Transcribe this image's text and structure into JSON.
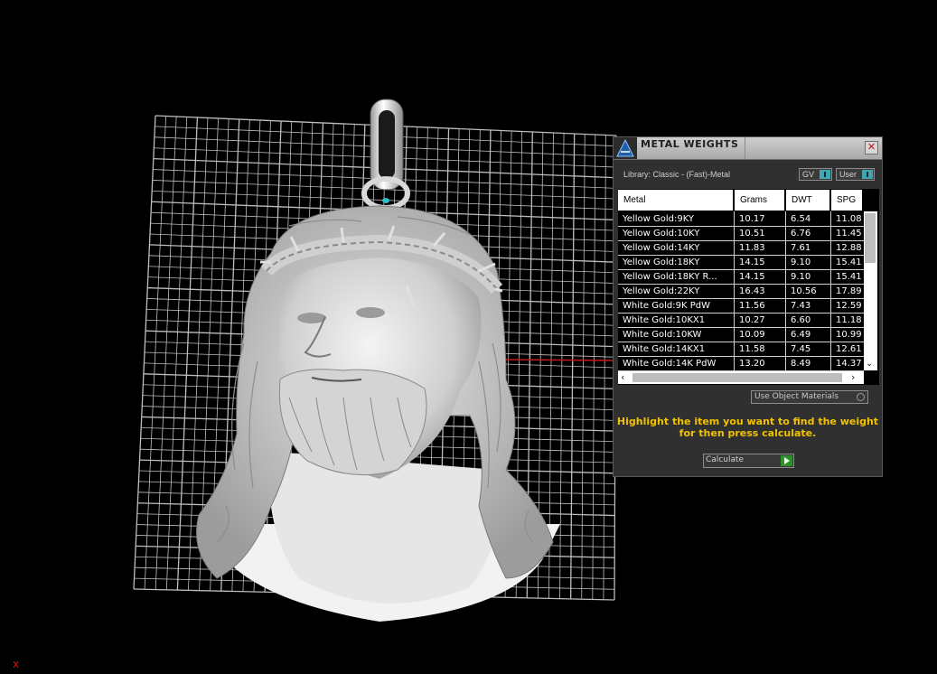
{
  "viewport": {
    "axis_label": "x",
    "grid_color": "#bdbdbd",
    "model": "jesus-head-pendant-icon"
  },
  "panel": {
    "title": "METAL WEIGHTS",
    "close_icon": "close-icon",
    "library_label": "Library: Classic - (Fast)-Metal",
    "gv_label": "GV",
    "user_label": "User",
    "table": {
      "columns": [
        "Metal",
        "Grams",
        "DWT",
        "SPG"
      ],
      "rows": [
        [
          "Yellow Gold:9KY",
          "10.17",
          "6.54",
          "11.08"
        ],
        [
          "Yellow Gold:10KY",
          "10.51",
          "6.76",
          "11.45"
        ],
        [
          "Yellow Gold:14KY",
          "11.83",
          "7.61",
          "12.88"
        ],
        [
          "Yellow Gold:18KY",
          "14.15",
          "9.10",
          "15.41"
        ],
        [
          "Yellow Gold:18KY R...",
          "14.15",
          "9.10",
          "15.41"
        ],
        [
          "Yellow Gold:22KY",
          "16.43",
          "10.56",
          "17.89"
        ],
        [
          "White Gold:9K PdW",
          "11.56",
          "7.43",
          "12.59"
        ],
        [
          "White Gold:10KX1",
          "10.27",
          "6.60",
          "11.18"
        ],
        [
          "White Gold:10KW",
          "10.09",
          "6.49",
          "10.99"
        ],
        [
          "White Gold:14KX1",
          "11.58",
          "7.45",
          "12.61"
        ],
        [
          "White Gold:14K PdW",
          "13.20",
          "8.49",
          "14.37"
        ]
      ]
    },
    "use_object_materials": "Use Object Materials",
    "instruction": "Highlight the item you want to find the weight for then press calculate.",
    "calculate_label": "Calculate",
    "accent": "#3ea7b2",
    "instruction_color": "#f2c200"
  }
}
